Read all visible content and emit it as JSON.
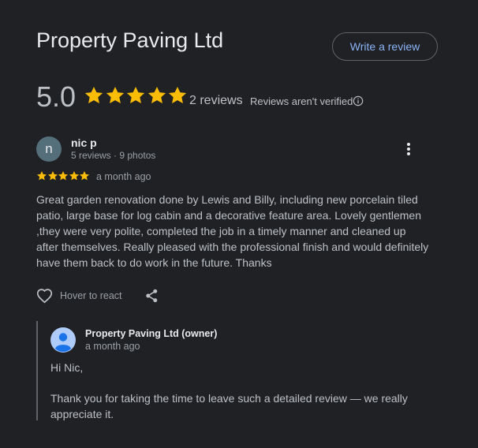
{
  "business": {
    "name": "Property Paving Ltd",
    "write_review_label": "Write a review"
  },
  "summary": {
    "rating": "5.0",
    "stars": 5,
    "reviews_count": "2 reviews",
    "verification_note": "Reviews aren't verified",
    "star_color": "#fbbc04"
  },
  "review": {
    "author_initial": "n",
    "author_name": "nic p",
    "author_meta": "5 reviews · 9 photos",
    "stars": 5,
    "date": "a month ago",
    "text": "Great garden renovation done by Lewis and Billy, including new porcelain tiled patio, large base for log cabin and a decorative feature area. Lovely gentlemen ,they were very polite, completed the job in a timely manner and cleaned up after themselves. Really pleased with the professional finish and would definitely have them back to do work in the future. Thanks",
    "react_label": "Hover to react"
  },
  "owner_reply": {
    "name": "Property Paving Ltd (owner)",
    "date": "a month ago",
    "greeting": "Hi Nic,",
    "body": "Thank you for taking the time to leave such a detailed review — we really appreciate it."
  },
  "colors": {
    "accent_link": "#8ab4f8",
    "background": "#202124",
    "avatar_bg": "#546e7a",
    "owner_avatar_bg": "#aecbfa"
  },
  "icons": {
    "info": "info-icon",
    "more": "more-vert-icon",
    "heart": "heart-icon",
    "share": "share-icon",
    "owner_avatar": "person-icon"
  }
}
